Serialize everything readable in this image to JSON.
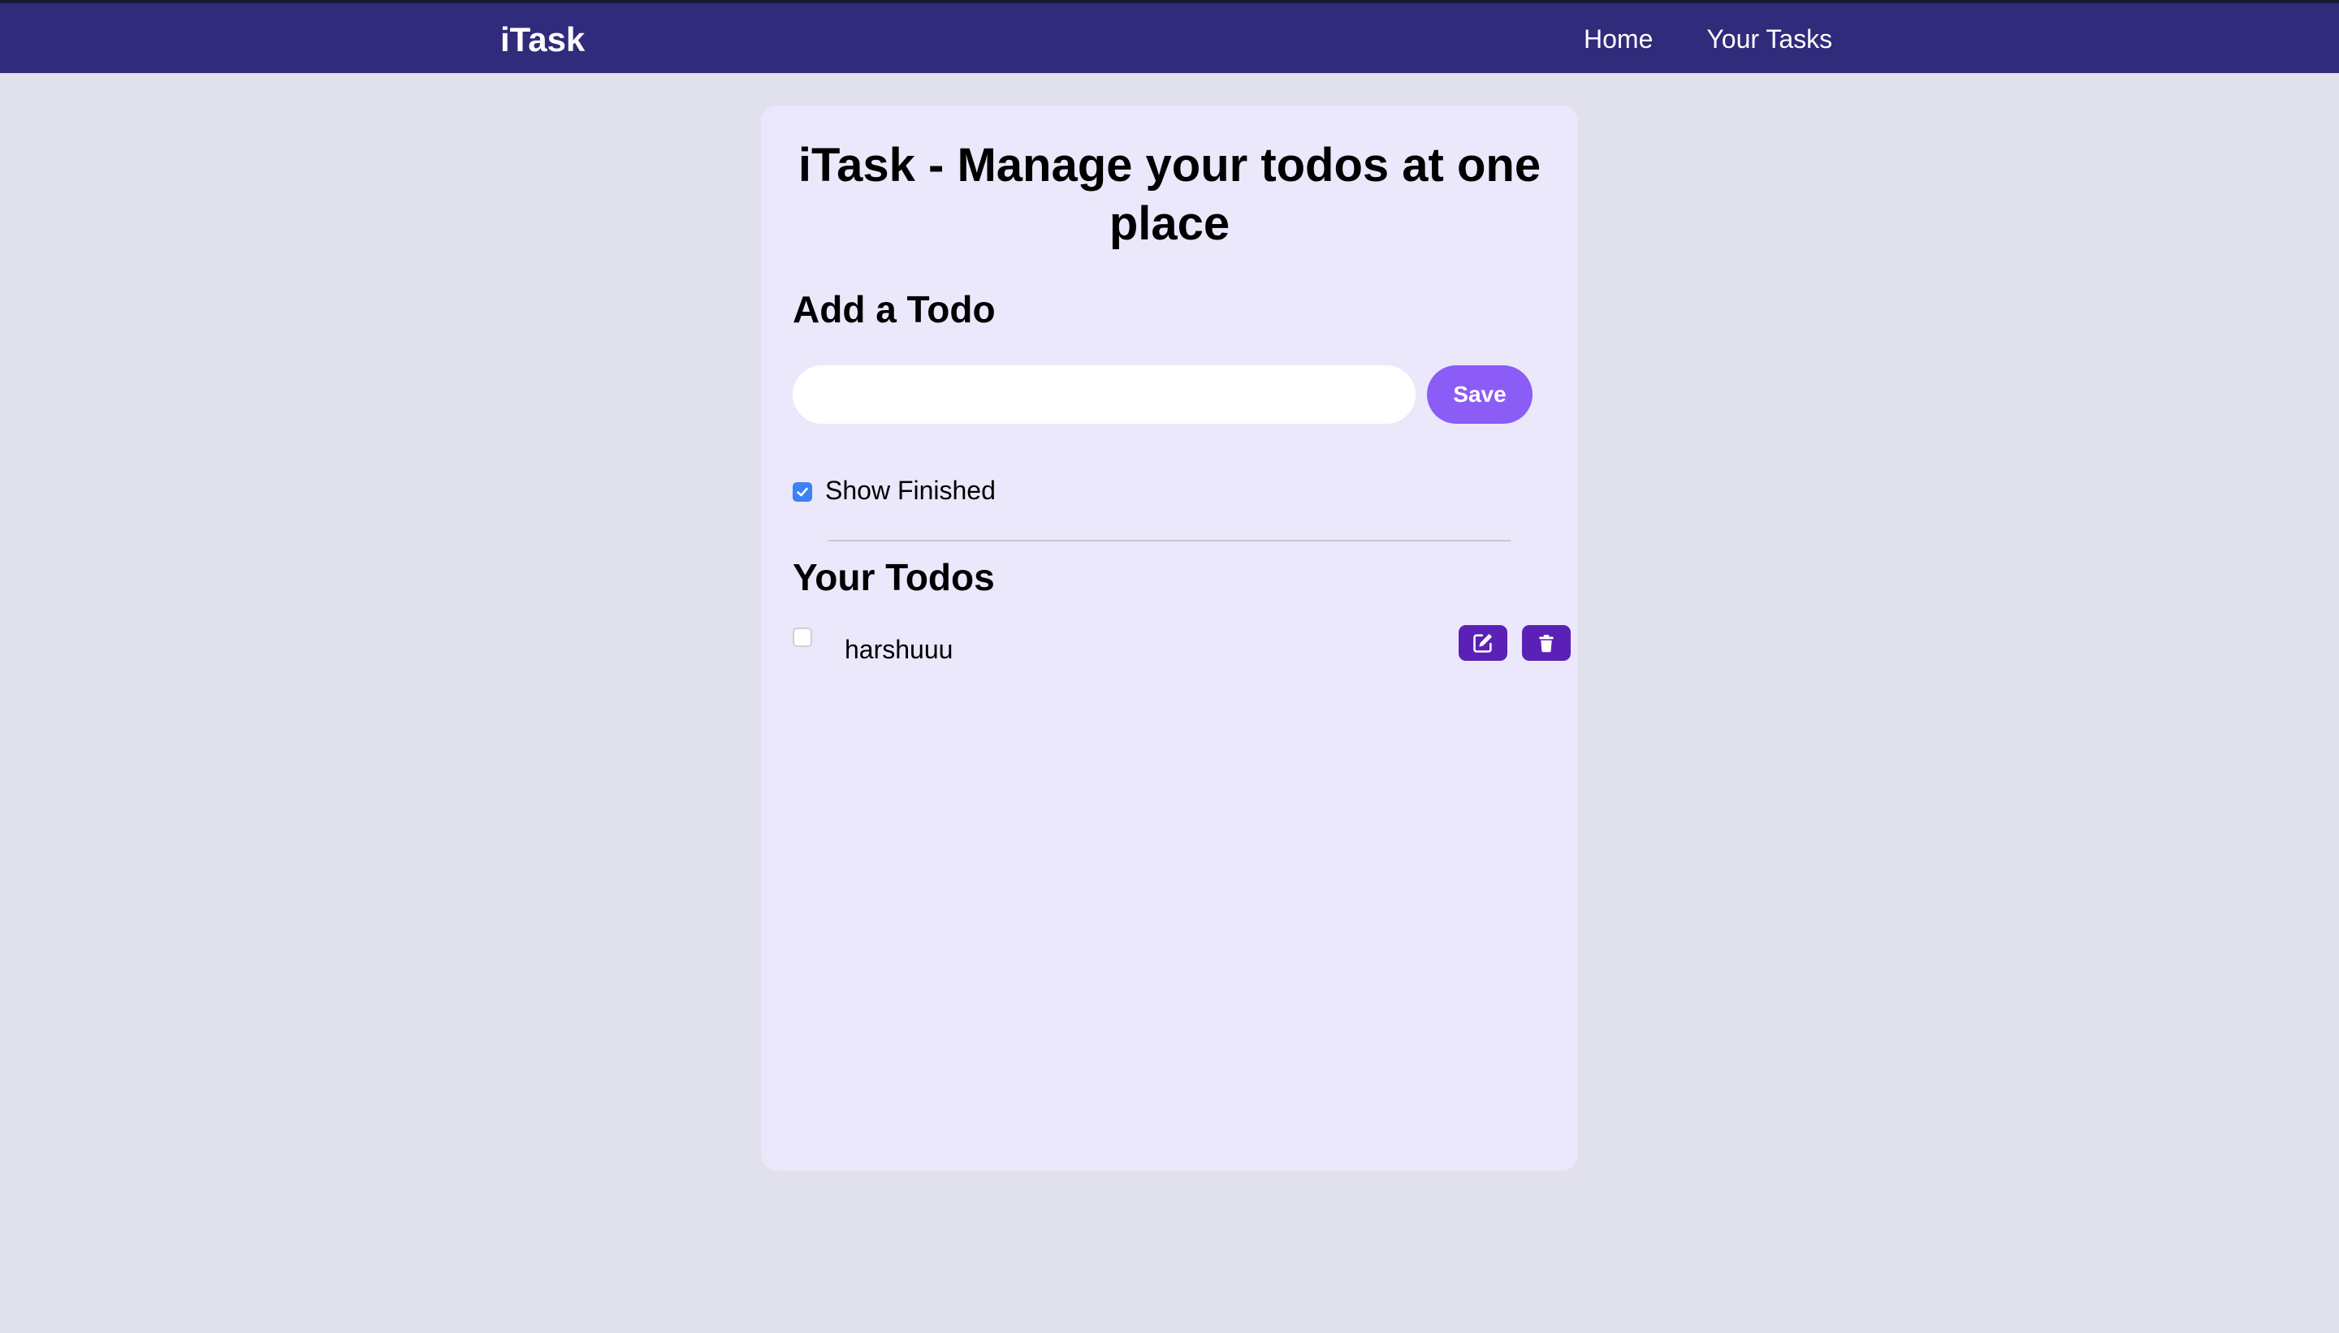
{
  "navbar": {
    "brand": "iTask",
    "links": [
      {
        "label": "Home"
      },
      {
        "label": "Your Tasks"
      }
    ]
  },
  "main": {
    "title": "iTask - Manage your todos at one place",
    "add_heading": "Add a Todo",
    "input": {
      "value": "",
      "placeholder": ""
    },
    "save_label": "Save",
    "show_finished": {
      "label": "Show Finished",
      "checked": true
    },
    "todos_heading": "Your Todos",
    "todos": [
      {
        "text": "harshuuu",
        "completed": false
      }
    ]
  },
  "icons": {
    "edit": "edit-icon",
    "delete": "trash-icon",
    "check": "check-icon"
  },
  "colors": {
    "navbar_bg": "#312b7b",
    "page_bg": "#e1e0ed",
    "card_bg": "#ebe8fb",
    "save_button": "#8b5cf6",
    "icon_button": "#5b21b6",
    "checkbox_checked": "#3b82f6"
  }
}
